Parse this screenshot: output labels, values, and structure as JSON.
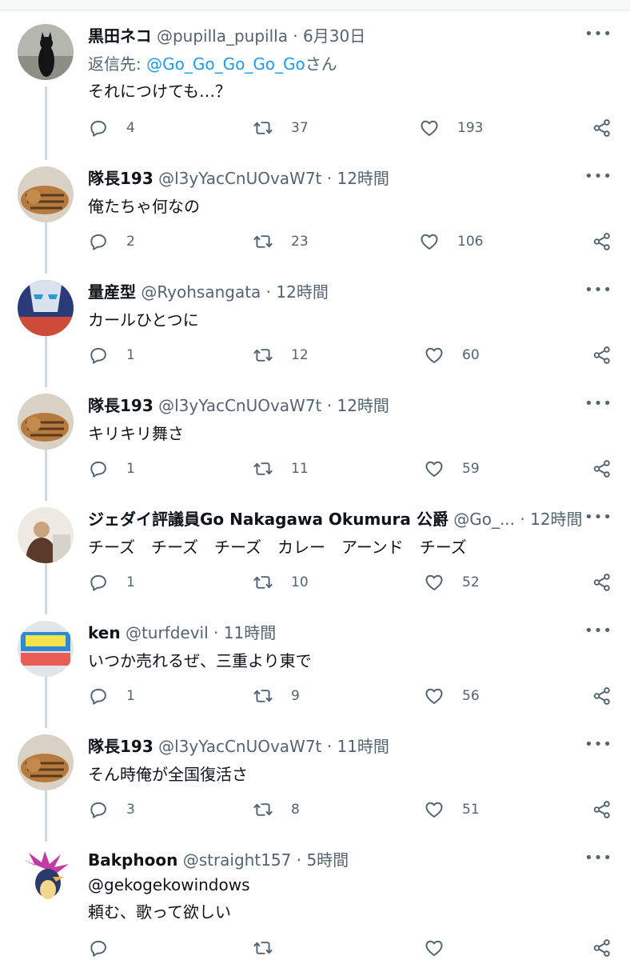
{
  "tweets": [
    {
      "name": "黒田ネコ",
      "handle": "@pupilla_pupilla",
      "time": "6月30日",
      "reply_prefix": "返信先: ",
      "reply_to": "@Go_Go_Go_Go_Go",
      "reply_suffix": "さん",
      "text": "それにつけても…？",
      "replies": "4",
      "retweets": "37",
      "likes": "193"
    },
    {
      "name": "隊長193",
      "handle": "@l3yYacCnUOvaW7t",
      "time": "12時間",
      "text": "俺たちゃ何なの",
      "replies": "2",
      "retweets": "23",
      "likes": "106"
    },
    {
      "name": "量産型",
      "handle": "@Ryohsangata",
      "time": "12時間",
      "text": "カールひとつに",
      "replies": "1",
      "retweets": "12",
      "likes": "60"
    },
    {
      "name": "隊長193",
      "handle": "@l3yYacCnUOvaW7t",
      "time": "12時間",
      "text": "キリキリ舞さ",
      "replies": "1",
      "retweets": "11",
      "likes": "59"
    },
    {
      "name": "ジェダイ評議員Go Nakagawa Okumura 公爵",
      "handle": "@Go_...",
      "time": "12時間",
      "text": "チーズ　チーズ　チーズ　カレー　アーンド　チーズ",
      "replies": "1",
      "retweets": "10",
      "likes": "52"
    },
    {
      "name": "ken",
      "handle": "@turfdevil",
      "time": "11時間",
      "text": "いつか売れるぜ、三重より東で",
      "replies": "1",
      "retweets": "9",
      "likes": "56"
    },
    {
      "name": "隊長193",
      "handle": "@l3yYacCnUOvaW7t",
      "time": "11時間",
      "text": "そん時俺が全国復活さ",
      "replies": "3",
      "retweets": "8",
      "likes": "51"
    },
    {
      "name": "Bakphoon",
      "handle": "@straight157",
      "time": "5時間",
      "mention": "@gekogekowindows",
      "text": "頼む、歌って欲しい",
      "replies": "",
      "retweets": "",
      "likes": ""
    }
  ],
  "separator": " · ",
  "more_label": "•••",
  "icons": {
    "reply": "reply-icon",
    "retweet": "retweet-icon",
    "like": "heart-icon",
    "share": "share-icon",
    "more": "more-icon"
  },
  "colors": {
    "accent": "#1d9bf0",
    "muted": "#536471",
    "text": "#0f1419",
    "thread_line": "#cfd9de"
  }
}
